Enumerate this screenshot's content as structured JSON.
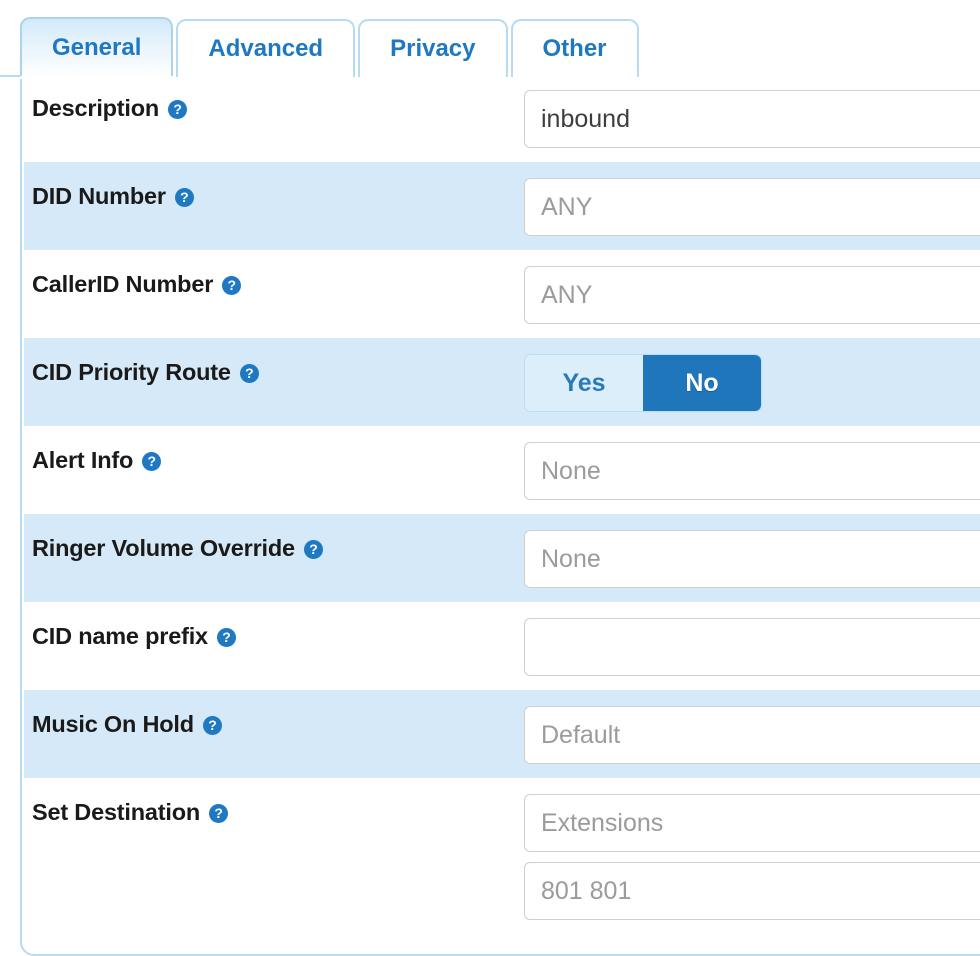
{
  "tabs": [
    {
      "label": "General",
      "active": true
    },
    {
      "label": "Advanced",
      "active": false
    },
    {
      "label": "Privacy",
      "active": false
    },
    {
      "label": "Other",
      "active": false
    }
  ],
  "help_icon": "?",
  "colors": {
    "accent": "#1f78c2",
    "tab_border": "#b7dbf2",
    "row_alt_bg": "#d6e9f8",
    "toggle_on_bg": "#1f76ba",
    "toggle_off_bg": "#ddeefb",
    "field_border": "#cfcfcf"
  },
  "form": {
    "rows": [
      {
        "label": "Description",
        "help": "help-icon",
        "striped": false,
        "control": "text",
        "value": "inbound",
        "is_placeholder": false
      },
      {
        "label": "DID Number",
        "help": "help-icon",
        "striped": true,
        "control": "text",
        "value": "ANY",
        "is_placeholder": true
      },
      {
        "label": "CallerID Number",
        "help": "help-icon",
        "striped": false,
        "control": "text",
        "value": "ANY",
        "is_placeholder": true
      },
      {
        "label": "CID Priority Route",
        "help": "help-icon",
        "striped": true,
        "control": "toggle",
        "options": [
          "Yes",
          "No"
        ],
        "selected": "No"
      },
      {
        "label": "Alert Info",
        "help": "help-icon",
        "striped": false,
        "control": "select",
        "value": "None",
        "is_placeholder": true
      },
      {
        "label": "Ringer Volume Override",
        "help": "help-icon",
        "striped": true,
        "control": "select",
        "value": "None",
        "is_placeholder": true
      },
      {
        "label": "CID name prefix",
        "help": "help-icon",
        "striped": false,
        "control": "text",
        "value": "",
        "is_placeholder": true
      },
      {
        "label": "Music On Hold",
        "help": "help-icon",
        "striped": true,
        "control": "select",
        "value": "Default",
        "is_placeholder": true
      },
      {
        "label": "Set Destination",
        "help": "help-icon",
        "striped": false,
        "control": "select-pair",
        "value": "Extensions",
        "value2": "801 801",
        "is_placeholder": true
      }
    ]
  }
}
